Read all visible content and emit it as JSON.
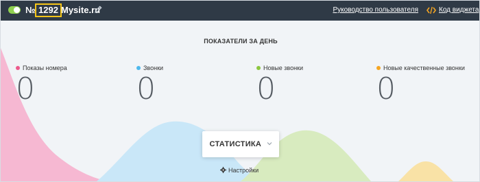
{
  "header": {
    "number_prefix": "№",
    "number": "1292",
    "site_name": "Mysite.ru",
    "guide_link": "Руководство пользователя",
    "code_link": "Код виджета"
  },
  "main": {
    "title": "ПОКАЗАТЕЛИ ЗА ДЕНЬ",
    "metrics": [
      {
        "label": "Показы номера",
        "value": "0",
        "color": "#ec5a8c"
      },
      {
        "label": "Звонки",
        "value": "0",
        "color": "#4db8ec"
      },
      {
        "label": "Новые звонки",
        "value": "0",
        "color": "#8cc63f"
      },
      {
        "label": "Новые качественные звонки",
        "value": "0",
        "color": "#f5a623"
      }
    ],
    "stats_button": "СТАТИСТИКА",
    "settings_link": "Настройки"
  },
  "colors": {
    "header_bg": "#2f3a46",
    "toggle_on": "#8fd14f",
    "number_highlight": "#f5c518",
    "wave_pink": "#f6b8d2",
    "wave_blue": "#c9e7f8",
    "wave_green": "#d8ebbf",
    "wave_yellow": "#f9e2a6"
  },
  "icons": {
    "edit": "pencil-icon",
    "code": "code-icon",
    "settings": "gear-icon",
    "dropdown": "chevron-down-icon"
  }
}
